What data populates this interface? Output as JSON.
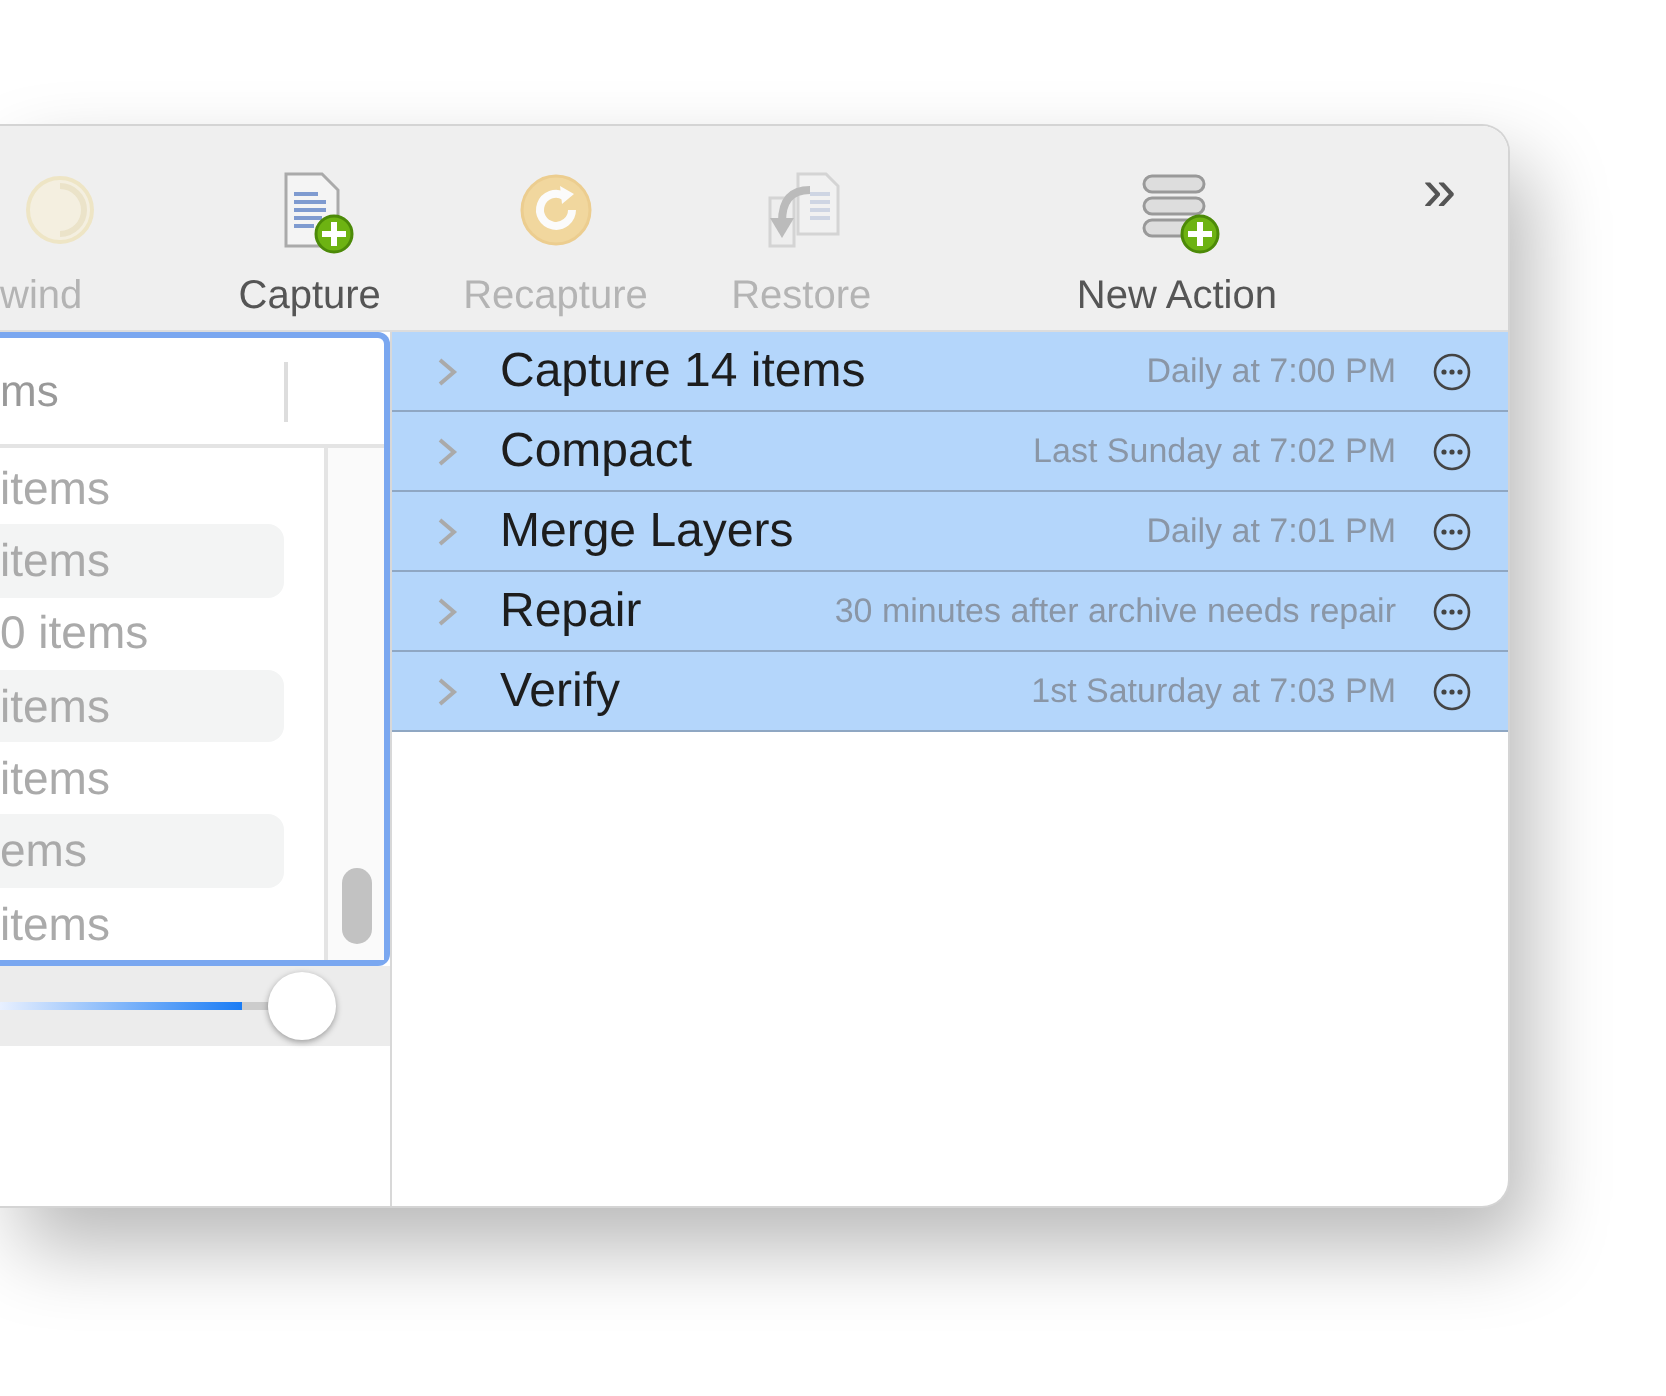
{
  "toolbar": {
    "items": [
      {
        "label": "wind",
        "kind": "rewind",
        "disabled": true
      },
      {
        "label": "Capture",
        "kind": "capture",
        "disabled": false
      },
      {
        "label": "Recapture",
        "kind": "recapture",
        "disabled": true
      },
      {
        "label": "Restore",
        "kind": "restore",
        "disabled": true
      },
      {
        "label": "New Action",
        "kind": "new-action",
        "disabled": false
      }
    ],
    "overflow": "»"
  },
  "sidebar": {
    "header": "ms",
    "items": [
      "items",
      "items",
      "0 items",
      "items",
      "items",
      "ems",
      "items"
    ],
    "slider": {
      "level": 0.9
    }
  },
  "actions": [
    {
      "name": "Capture 14 items",
      "schedule": "Daily at 7:00 PM",
      "selected": true
    },
    {
      "name": "Compact",
      "schedule": "Last Sunday at 7:02 PM",
      "selected": true
    },
    {
      "name": "Merge Layers",
      "schedule": "Daily at 7:01 PM",
      "selected": true
    },
    {
      "name": "Repair",
      "schedule": "30 minutes after archive needs repair",
      "selected": true
    },
    {
      "name": "Verify",
      "schedule": "1st Saturday at 7:03 PM",
      "selected": true
    }
  ]
}
